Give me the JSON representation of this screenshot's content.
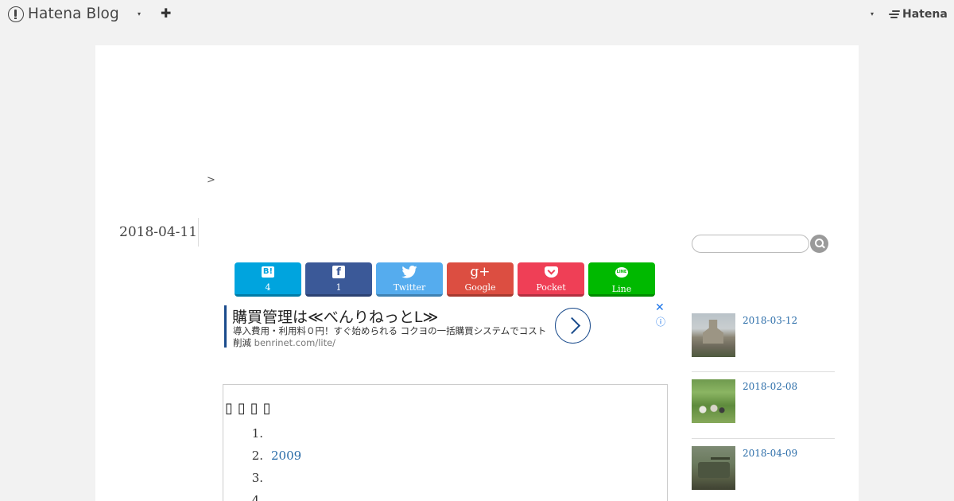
{
  "global_header": {
    "logo_text": "Hatena Blog",
    "caret_icon": "▾",
    "plus_icon": "✚",
    "hatena_text": "Hatena"
  },
  "breadcrumb": {
    "separator": ">"
  },
  "entry": {
    "date": "2018-04-11"
  },
  "share_buttons": [
    {
      "name": "hatena-bookmark",
      "icon": "B!",
      "label": "4",
      "color": "#00a4de"
    },
    {
      "name": "facebook",
      "icon": "f",
      "label": "1",
      "color": "#3b5998"
    },
    {
      "name": "twitter",
      "icon": "twitter-bird",
      "label": "Twitter",
      "color": "#55acee"
    },
    {
      "name": "google-plus",
      "icon": "g+",
      "label": "Google",
      "color": "#dc4e41"
    },
    {
      "name": "pocket",
      "icon": "pocket",
      "label": "Pocket",
      "color": "#ef3f56"
    },
    {
      "name": "line",
      "icon": "LINE",
      "label": "Line",
      "color": "#00b900"
    }
  ],
  "ad": {
    "title": "購買管理は≪べんりねっとL≫",
    "description": "導入費用・利用料０円！すぐ始められる コクヨの一括購買システムでコスト削減",
    "url": "benrinet.com/lite/",
    "close_icon": "✕",
    "info_icon": "ⓘ"
  },
  "content": {
    "heading_glyphs": "▯▯▯▯",
    "list": [
      {
        "num": "1.",
        "text": ""
      },
      {
        "num": "2.",
        "text": "2009"
      },
      {
        "num": "3.",
        "text": ""
      },
      {
        "num": "4.",
        "text": ""
      }
    ]
  },
  "sidebar": {
    "entries": [
      {
        "date": "2018-03-12"
      },
      {
        "date": "2018-02-08"
      },
      {
        "date": "2018-04-09"
      }
    ]
  }
}
